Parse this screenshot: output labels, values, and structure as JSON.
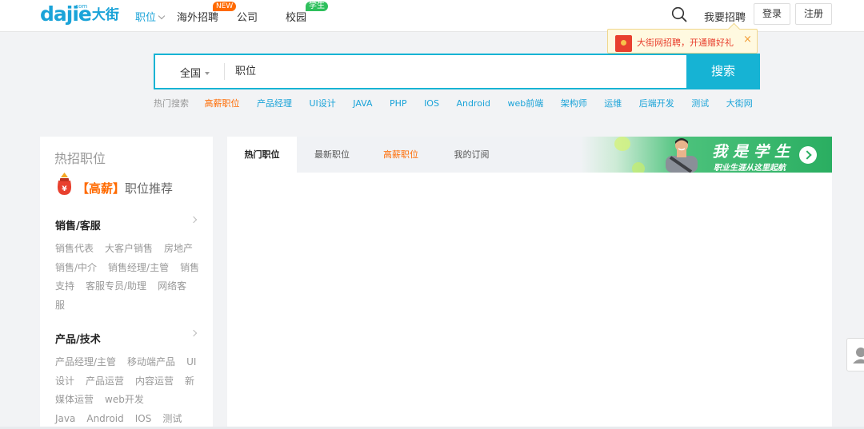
{
  "header": {
    "logo_latin": "dajie",
    "logo_com": ".com",
    "logo_cn": "大街",
    "nav": [
      {
        "label": "职位",
        "active": true
      },
      {
        "label": "海外招聘",
        "badge": "NEW"
      },
      {
        "label": "公司"
      },
      {
        "label": "校园",
        "badge": "学生"
      }
    ],
    "hire_link": "我要招聘",
    "login": "登录",
    "register": "注册"
  },
  "promo": {
    "text": "大街网招聘，开通赠好礼",
    "close": "×"
  },
  "search": {
    "city": "全国",
    "placeholder": "职位",
    "button": "搜索"
  },
  "hot_searches": {
    "label": "热门搜索",
    "items": [
      "高薪职位",
      "产品经理",
      "UI设计",
      "JAVA",
      "PHP",
      "IOS",
      "Android",
      "web前端",
      "架构师",
      "运维",
      "后端开发",
      "测试",
      "大街网"
    ],
    "highlight_index": 0
  },
  "left_panel": {
    "title": "热招职位",
    "rec_highlight": "【高薪】",
    "rec_text": "职位推荐",
    "categories": [
      {
        "title": "销售/客服",
        "tags": [
          "销售代表",
          "大客户销售",
          "房地产销售/中介",
          "销售经理/主管",
          "销售支持",
          "客服专员/助理",
          "网络客服"
        ]
      },
      {
        "title": "产品/技术",
        "tags": [
          "产品经理/主管",
          "移动端产品",
          "UI设计",
          "产品运营",
          "内容运营",
          "新媒体运营",
          "web开发",
          "Java",
          "Android",
          "IOS",
          "测试"
        ]
      }
    ]
  },
  "main_panel": {
    "tabs": [
      {
        "label": "热门职位",
        "active": true
      },
      {
        "label": "最新职位"
      },
      {
        "label": "高薪职位",
        "highlight": true
      },
      {
        "label": "我的订阅"
      }
    ],
    "banner": {
      "title": "我是学生",
      "subtitle": "职业生涯从这里起航"
    }
  },
  "icons": [
    "search-icon",
    "chevron-down-icon",
    "red-envelope-icon",
    "close-icon",
    "money-bag-icon",
    "chevron-right-icon",
    "arrow-right-icon",
    "customer-service-icon"
  ],
  "colors": {
    "brand": "#1aa3d8",
    "search": "#16b3d4",
    "highlight": "#ff6a00",
    "student": "#2ec05c",
    "promo_text": "#e8402e"
  }
}
